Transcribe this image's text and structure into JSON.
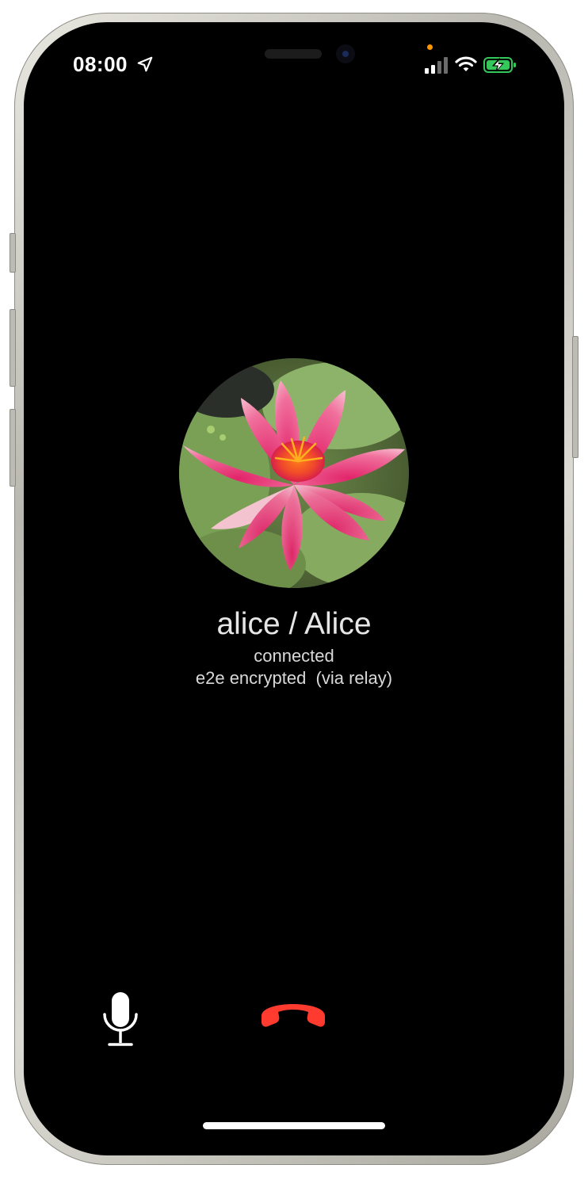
{
  "status_bar": {
    "time": "08:00",
    "location_icon": "location-arrow-icon",
    "signal_icon": "cellular-signal-icon",
    "wifi_icon": "wifi-icon",
    "battery_icon": "battery-charging-icon",
    "battery_color": "#34c759",
    "privacy_dot_color": "#ff9500"
  },
  "call": {
    "avatar_icon": "pink-water-lily-photo",
    "caller_name": "alice / Alice",
    "status": "connected",
    "encryption": "e2e encrypted  (via relay)"
  },
  "controls": {
    "mic_icon": "microphone-icon",
    "end_call_icon": "end-call-icon",
    "end_call_color": "#ff3b30"
  }
}
